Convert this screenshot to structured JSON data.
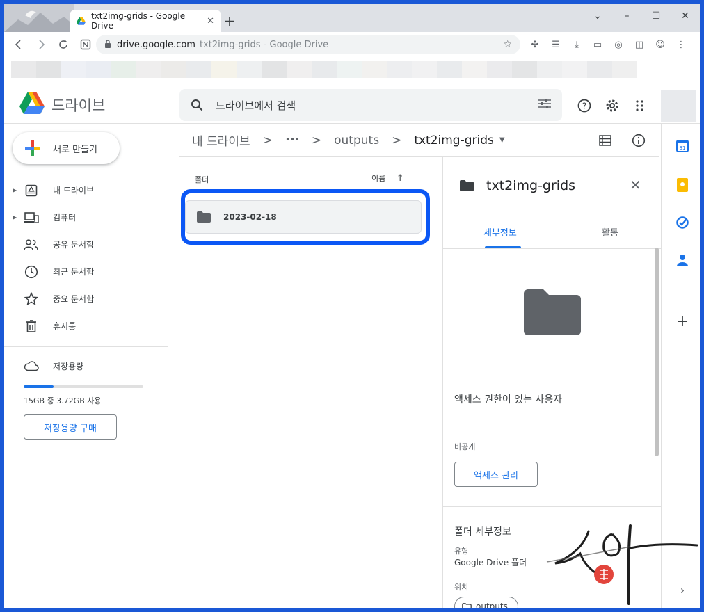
{
  "browser": {
    "tab_title": "txt2img-grids - Google Drive",
    "url_host": "drive.google.com",
    "url_rest": "txt2img-grids - Google Drive",
    "window_controls": [
      "⌄",
      "–",
      "☐",
      "✕"
    ]
  },
  "header": {
    "brand": "드라이브",
    "search_placeholder": "드라이브에서 검색"
  },
  "sidebar": {
    "new_button": "새로 만들기",
    "items": [
      {
        "label": "내 드라이브",
        "icon": "my-drive-icon",
        "caret": true
      },
      {
        "label": "컴퓨터",
        "icon": "computer-icon",
        "caret": true
      },
      {
        "label": "공유 문서함",
        "icon": "shared-icon",
        "caret": false
      },
      {
        "label": "최근 문서함",
        "icon": "clock-icon",
        "caret": false
      },
      {
        "label": "중요 문서함",
        "icon": "star-icon",
        "caret": false
      },
      {
        "label": "휴지통",
        "icon": "trash-icon",
        "caret": false
      }
    ],
    "storage_label": "저장용량",
    "storage_usage": "15GB 중 3.72GB 사용",
    "storage_fraction": 0.248,
    "buy_button": "저장용량 구매"
  },
  "breadcrumb": {
    "root": "내 드라이브",
    "ellipsis": "•••",
    "middle": "outputs",
    "current": "txt2img-grids",
    "separator": ">"
  },
  "files": {
    "section_label": "폴더",
    "sort_label": "이름",
    "sort_arrow": "↑",
    "folders": [
      {
        "name": "2023-02-18"
      }
    ]
  },
  "details": {
    "title": "txt2img-grids",
    "tab_details": "세부정보",
    "tab_activity": "활동",
    "access_heading": "액세스 권한이 있는 사용자",
    "visibility": "비공개",
    "manage_button": "액세스 관리",
    "folder_details_heading": "폴더 세부정보",
    "type_label": "유형",
    "type_value": "Google Drive 폴더",
    "location_label": "위치",
    "location_value": "outputs"
  },
  "colors": {
    "accent": "#1a73e8",
    "highlight": "#0b57f5",
    "frame": "#1a58d6"
  }
}
